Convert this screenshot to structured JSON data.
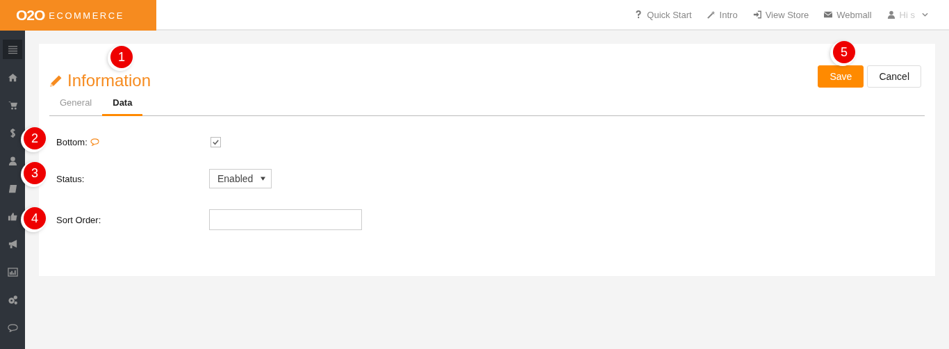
{
  "logo": {
    "mark": "O2O",
    "word": "ECOMMERCE"
  },
  "top_links": [
    {
      "label": "Quick Start"
    },
    {
      "label": "Intro"
    },
    {
      "label": "View Store"
    },
    {
      "label": "Webmall"
    }
  ],
  "user_menu": {
    "label": "Hi s"
  },
  "sidebar": {
    "items": [
      {
        "selected": true
      },
      {
        "selected": false
      },
      {
        "selected": false
      },
      {
        "selected": false
      },
      {
        "selected": false
      },
      {
        "selected": false
      },
      {
        "selected": false
      },
      {
        "selected": false
      },
      {
        "selected": false
      },
      {
        "selected": false
      },
      {
        "selected": false
      }
    ]
  },
  "page": {
    "title": "Information"
  },
  "buttons": [
    {
      "label": "Save",
      "kind": "primary"
    },
    {
      "label": "Cancel",
      "kind": "default"
    }
  ],
  "tabs": [
    {
      "label": "General",
      "selected": false
    },
    {
      "label": "Data",
      "selected": true
    }
  ],
  "fields": [
    {
      "label": "Bottom:",
      "kind": "checkbox",
      "help": true,
      "checked": true
    },
    {
      "label": "Status:",
      "kind": "select",
      "value": "Enabled"
    },
    {
      "label": "Sort Order:",
      "kind": "text"
    }
  ],
  "callouts": [
    "1",
    "2",
    "3",
    "4",
    "5"
  ]
}
